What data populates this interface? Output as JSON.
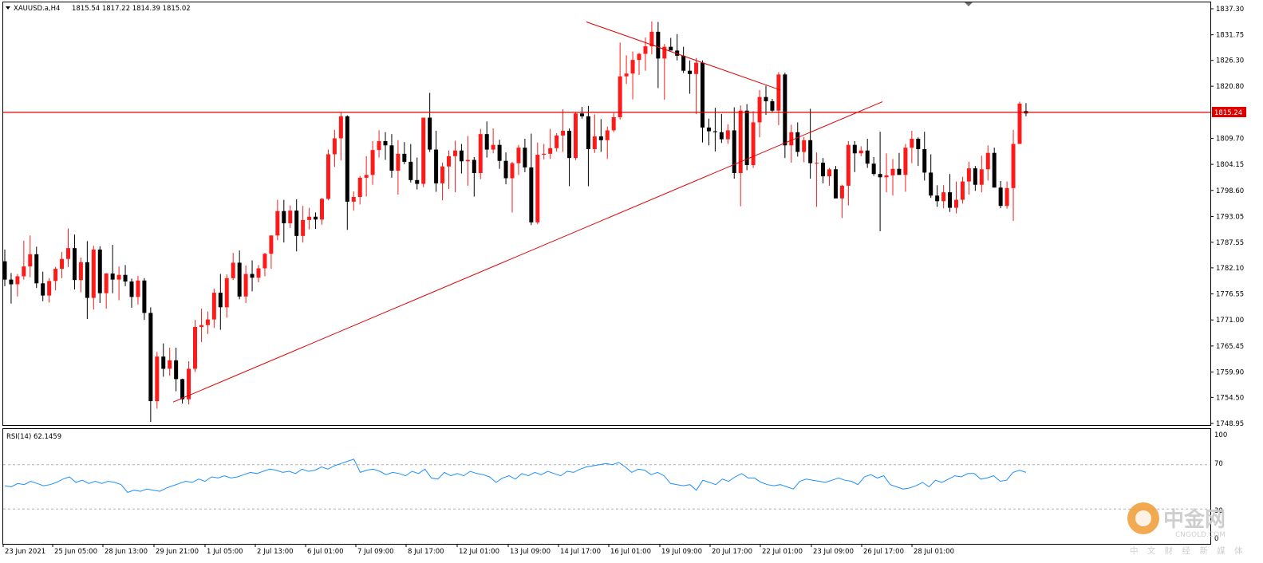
{
  "header": {
    "symbol": "XAUUSD.a,H4",
    "ohlc": "1815.54 1817.22 1814.39 1815.02"
  },
  "rsi": {
    "label": "RSI(14) 62.1459",
    "levels": [
      "100",
      "70",
      "30",
      "0"
    ],
    "values": [
      51,
      50,
      53,
      52,
      55,
      53,
      51,
      52,
      54,
      57,
      59,
      54,
      56,
      53,
      55,
      53,
      55,
      54,
      52,
      45,
      47,
      46,
      48,
      47,
      46,
      49,
      51,
      53,
      55,
      54,
      57,
      55,
      59,
      58,
      60,
      58,
      59,
      61,
      63,
      62,
      64,
      66,
      65,
      63,
      64,
      62,
      66,
      64,
      65,
      68,
      66,
      69,
      71,
      73,
      75,
      63,
      65,
      66,
      64,
      61,
      63,
      62,
      60,
      64,
      62,
      66,
      58,
      57,
      63,
      60,
      62,
      60,
      64,
      62,
      61,
      59,
      54,
      58,
      60,
      57,
      62,
      60,
      63,
      61,
      64,
      62,
      60,
      64,
      63,
      66,
      68,
      69,
      70,
      71,
      70,
      72,
      68,
      63,
      66,
      65,
      61,
      63,
      60,
      53,
      52,
      51,
      52,
      47,
      56,
      54,
      52,
      57,
      55,
      59,
      62,
      58,
      58,
      54,
      52,
      51,
      52,
      50,
      48,
      55,
      57,
      56,
      55,
      54,
      56,
      58,
      56,
      55,
      52,
      59,
      61,
      58,
      60,
      52,
      50,
      48,
      49,
      51,
      54,
      50,
      56,
      54,
      57,
      60,
      59,
      62,
      62,
      57,
      58,
      60,
      55,
      56,
      63,
      65,
      63
    ],
    "color": "#1e90ff"
  },
  "price_axis": {
    "labels": [
      "1837.30",
      "1831.75",
      "1826.30",
      "1820.80",
      "1809.70",
      "1804.15",
      "1798.60",
      "1793.05",
      "1787.55",
      "1782.10",
      "1776.55",
      "1771.00",
      "1765.45",
      "1759.90",
      "1754.50",
      "1748.95"
    ],
    "current_price": "1815.24",
    "current_price_color": "#e00000"
  },
  "time_axis": {
    "labels": [
      "23 Jun 2021",
      "25 Jun 05:00",
      "28 Jun 13:00",
      "29 Jun 21:00",
      "1 Jul 05:00",
      "2 Jul 13:00",
      "6 Jul 01:00",
      "7 Jul 09:00",
      "8 Jul 17:00",
      "12 Jul 01:00",
      "13 Jul 09:00",
      "14 Jul 17:00",
      "16 Jul 01:00",
      "19 Jul 09:00",
      "20 Jul 17:00",
      "22 Jul 01:00",
      "23 Jul 09:00",
      "26 Jul 17:00",
      "28 Jul 01:00"
    ]
  },
  "watermark": {
    "chinese": "中金网",
    "english": "CNGOLD.COM",
    "subtitle": "中 文 财 经 新 媒 体"
  },
  "chart_data": {
    "type": "candlestick",
    "symbol": "XAUUSD.a",
    "timeframe": "H4",
    "y_range": [
      1748.95,
      1837.3
    ],
    "colors": {
      "bull": "#ff1a1a",
      "bear": "#000000",
      "lines": "#e00000"
    },
    "horizontal_line": 1815.24,
    "trendlines": [
      {
        "name": "support",
        "from": [
          "29 Jun 21:00",
          1753.5
        ],
        "to": [
          "23 Jul 09:00",
          1816.5
        ]
      },
      {
        "name": "resistance",
        "from": [
          "14 Jul 17:00",
          1834.5
        ],
        "to": [
          "20 Jul 17:00",
          1822.5
        ]
      }
    ],
    "candles": [
      [
        1783.5,
        1786.0,
        1778.2,
        1779.6
      ],
      [
        1779.6,
        1781.0,
        1774.5,
        1778.6
      ],
      [
        1778.6,
        1780.8,
        1776.0,
        1780.3
      ],
      [
        1780.3,
        1787.9,
        1779.6,
        1782.4
      ],
      [
        1782.4,
        1789.0,
        1780.1,
        1785.0
      ],
      [
        1785.0,
        1786.6,
        1777.8,
        1778.8
      ],
      [
        1778.8,
        1781.3,
        1775.0,
        1776.2
      ],
      [
        1776.2,
        1779.9,
        1774.7,
        1779.3
      ],
      [
        1779.3,
        1782.3,
        1777.3,
        1781.9
      ],
      [
        1781.9,
        1785.5,
        1779.9,
        1784.0
      ],
      [
        1784.0,
        1790.5,
        1782.3,
        1786.3
      ],
      [
        1786.3,
        1789.2,
        1777.5,
        1779.5
      ],
      [
        1779.5,
        1784.3,
        1776.9,
        1783.3
      ],
      [
        1783.3,
        1787.8,
        1771.2,
        1775.7
      ],
      [
        1775.7,
        1786.8,
        1773.2,
        1786.0
      ],
      [
        1786.0,
        1786.7,
        1774.6,
        1776.7
      ],
      [
        1776.7,
        1781.0,
        1773.4,
        1780.9
      ],
      [
        1780.9,
        1787.0,
        1776.7,
        1779.6
      ],
      [
        1779.6,
        1782.4,
        1775.2,
        1780.6
      ],
      [
        1780.6,
        1782.7,
        1778.2,
        1779.2
      ],
      [
        1779.2,
        1779.8,
        1773.6,
        1775.9
      ],
      [
        1775.9,
        1780.4,
        1774.3,
        1779.4
      ],
      [
        1779.4,
        1779.9,
        1771.0,
        1772.5
      ],
      [
        1772.5,
        1773.7,
        1749.3,
        1753.7
      ],
      [
        1753.7,
        1764.2,
        1752.1,
        1763.2
      ],
      [
        1763.2,
        1766.0,
        1758.9,
        1760.6
      ],
      [
        1760.6,
        1765.1,
        1759.1,
        1762.4
      ],
      [
        1762.4,
        1765.1,
        1755.8,
        1758.4
      ],
      [
        1758.4,
        1758.5,
        1753.2,
        1754.1
      ],
      [
        1754.1,
        1762.2,
        1753.0,
        1760.6
      ],
      [
        1760.6,
        1771.0,
        1759.9,
        1769.5
      ],
      [
        1769.5,
        1773.4,
        1766.3,
        1769.9
      ],
      [
        1769.9,
        1772.8,
        1768.0,
        1771.1
      ],
      [
        1771.1,
        1777.7,
        1769.3,
        1776.8
      ],
      [
        1776.8,
        1780.8,
        1768.9,
        1773.7
      ],
      [
        1773.7,
        1780.7,
        1771.5,
        1779.9
      ],
      [
        1779.9,
        1785.3,
        1779.5,
        1783.2
      ],
      [
        1783.2,
        1785.8,
        1775.4,
        1776.0
      ],
      [
        1776.0,
        1782.6,
        1774.6,
        1780.8
      ],
      [
        1780.8,
        1783.7,
        1777.1,
        1780.0
      ],
      [
        1780.0,
        1782.7,
        1779.0,
        1782.0
      ],
      [
        1782.0,
        1785.3,
        1780.3,
        1785.1
      ],
      [
        1785.1,
        1789.0,
        1781.9,
        1789.0
      ],
      [
        1789.0,
        1796.6,
        1788.0,
        1794.2
      ],
      [
        1794.2,
        1796.6,
        1787.5,
        1791.6
      ],
      [
        1791.6,
        1795.4,
        1790.6,
        1794.3
      ],
      [
        1794.3,
        1796.7,
        1785.6,
        1788.9
      ],
      [
        1788.9,
        1795.3,
        1787.5,
        1792.3
      ],
      [
        1792.3,
        1794.9,
        1790.3,
        1793.0
      ],
      [
        1793.0,
        1793.9,
        1790.4,
        1792.4
      ],
      [
        1792.4,
        1797.0,
        1791.3,
        1796.8
      ],
      [
        1796.8,
        1807.3,
        1796.5,
        1806.3
      ],
      [
        1806.3,
        1811.5,
        1803.6,
        1809.7
      ],
      [
        1809.7,
        1815.3,
        1805.0,
        1814.4
      ],
      [
        1814.4,
        1814.6,
        1790.2,
        1796.2
      ],
      [
        1796.2,
        1798.4,
        1794.3,
        1797.2
      ],
      [
        1797.2,
        1801.7,
        1795.6,
        1801.3
      ],
      [
        1801.3,
        1805.9,
        1797.3,
        1801.9
      ],
      [
        1801.9,
        1809.1,
        1799.8,
        1807.2
      ],
      [
        1807.2,
        1811.4,
        1805.6,
        1809.1
      ],
      [
        1809.1,
        1811.0,
        1805.1,
        1808.2
      ],
      [
        1808.2,
        1810.6,
        1801.3,
        1802.8
      ],
      [
        1802.8,
        1809.3,
        1797.7,
        1806.4
      ],
      [
        1806.4,
        1808.9,
        1804.2,
        1804.7
      ],
      [
        1804.7,
        1808.5,
        1800.3,
        1800.8
      ],
      [
        1800.8,
        1805.6,
        1798.8,
        1800.0
      ],
      [
        1800.0,
        1813.9,
        1799.3,
        1814.1
      ],
      [
        1814.1,
        1819.4,
        1806.8,
        1807.3
      ],
      [
        1807.3,
        1811.3,
        1798.3,
        1800.1
      ],
      [
        1800.1,
        1804.5,
        1796.5,
        1803.7
      ],
      [
        1803.7,
        1807.1,
        1798.9,
        1805.9
      ],
      [
        1805.9,
        1809.2,
        1798.2,
        1807.1
      ],
      [
        1807.1,
        1808.5,
        1802.2,
        1804.8
      ],
      [
        1804.8,
        1810.2,
        1799.6,
        1805.1
      ],
      [
        1805.1,
        1805.7,
        1797.3,
        1802.3
      ],
      [
        1802.3,
        1811.7,
        1801.0,
        1810.6
      ],
      [
        1810.6,
        1813.3,
        1805.6,
        1807.3
      ],
      [
        1807.3,
        1811.8,
        1806.5,
        1808.3
      ],
      [
        1808.3,
        1809.4,
        1803.2,
        1804.9
      ],
      [
        1804.9,
        1806.7,
        1799.9,
        1801.2
      ],
      [
        1801.2,
        1804.7,
        1793.9,
        1804.4
      ],
      [
        1804.4,
        1808.3,
        1801.9,
        1807.7
      ],
      [
        1807.7,
        1809.6,
        1802.5,
        1803.5
      ],
      [
        1803.5,
        1810.7,
        1791.2,
        1791.8
      ],
      [
        1791.8,
        1808.8,
        1791.4,
        1806.2
      ],
      [
        1806.2,
        1808.5,
        1805.2,
        1806.4
      ],
      [
        1806.4,
        1811.7,
        1805.3,
        1807.6
      ],
      [
        1807.6,
        1810.8,
        1806.9,
        1810.3
      ],
      [
        1810.3,
        1815.9,
        1806.8,
        1811.3
      ],
      [
        1811.3,
        1811.8,
        1799.5,
        1805.5
      ],
      [
        1805.5,
        1815.3,
        1805.1,
        1815.0
      ],
      [
        1815.0,
        1816.4,
        1813.9,
        1814.4
      ],
      [
        1814.4,
        1816.6,
        1799.5,
        1807.4
      ],
      [
        1807.4,
        1814.8,
        1806.6,
        1810.1
      ],
      [
        1810.1,
        1813.8,
        1806.8,
        1809.3
      ],
      [
        1809.3,
        1812.2,
        1805.3,
        1811.4
      ],
      [
        1811.4,
        1815.1,
        1811.0,
        1814.2
      ],
      [
        1814.2,
        1830.1,
        1813.7,
        1822.9
      ],
      [
        1822.9,
        1827.4,
        1821.3,
        1823.5
      ],
      [
        1823.5,
        1828.2,
        1818.0,
        1826.4
      ],
      [
        1826.4,
        1827.9,
        1823.2,
        1827.7
      ],
      [
        1827.7,
        1831.2,
        1824.1,
        1829.3
      ],
      [
        1829.3,
        1834.6,
        1827.6,
        1832.4
      ],
      [
        1832.4,
        1834.5,
        1820.4,
        1826.7
      ],
      [
        1826.7,
        1829.8,
        1817.9,
        1829.2
      ],
      [
        1829.2,
        1831.1,
        1828.5,
        1828.4
      ],
      [
        1828.4,
        1831.9,
        1826.3,
        1827.3
      ],
      [
        1827.3,
        1829.2,
        1823.6,
        1824.1
      ],
      [
        1824.1,
        1826.3,
        1819.2,
        1823.4
      ],
      [
        1823.4,
        1826.8,
        1814.9,
        1825.8
      ],
      [
        1825.8,
        1826.3,
        1808.8,
        1812.0
      ],
      [
        1812.0,
        1813.9,
        1808.2,
        1811.2
      ],
      [
        1811.2,
        1816.2,
        1806.9,
        1811.0
      ],
      [
        1811.0,
        1814.9,
        1808.7,
        1809.5
      ],
      [
        1809.5,
        1812.7,
        1808.5,
        1811.4
      ],
      [
        1811.4,
        1816.3,
        1801.1,
        1802.3
      ],
      [
        1802.3,
        1816.7,
        1795.2,
        1815.6
      ],
      [
        1815.6,
        1817.0,
        1802.9,
        1804.0
      ],
      [
        1804.0,
        1815.5,
        1803.4,
        1813.1
      ],
      [
        1813.1,
        1820.0,
        1809.9,
        1818.5
      ],
      [
        1818.5,
        1820.9,
        1814.7,
        1817.6
      ],
      [
        1817.6,
        1818.1,
        1815.3,
        1815.6
      ],
      [
        1815.6,
        1823.8,
        1812.5,
        1823.3
      ],
      [
        1823.3,
        1823.7,
        1805.5,
        1808.2
      ],
      [
        1808.2,
        1812.6,
        1804.5,
        1811.0
      ],
      [
        1811.0,
        1813.1,
        1805.8,
        1806.8
      ],
      [
        1806.8,
        1810.0,
        1804.6,
        1809.3
      ],
      [
        1809.3,
        1816.0,
        1801.1,
        1804.4
      ],
      [
        1804.4,
        1806.7,
        1795.1,
        1804.5
      ],
      [
        1804.5,
        1805.5,
        1800.1,
        1801.6
      ],
      [
        1801.6,
        1803.4,
        1799.6,
        1803.1
      ],
      [
        1803.1,
        1803.8,
        1800.1,
        1796.9
      ],
      [
        1796.9,
        1799.8,
        1792.7,
        1799.6
      ],
      [
        1799.6,
        1809.1,
        1795.4,
        1808.3
      ],
      [
        1808.3,
        1809.1,
        1802.5,
        1806.5
      ],
      [
        1806.5,
        1808.0,
        1805.9,
        1807.1
      ],
      [
        1807.1,
        1809.6,
        1803.4,
        1804.3
      ],
      [
        1804.3,
        1805.7,
        1801.7,
        1802.1
      ],
      [
        1802.1,
        1811.1,
        1789.9,
        1801.4
      ],
      [
        1801.4,
        1806.5,
        1798.2,
        1801.8
      ],
      [
        1801.8,
        1805.3,
        1797.5,
        1803.2
      ],
      [
        1803.2,
        1806.6,
        1802.0,
        1801.9
      ],
      [
        1801.9,
        1808.5,
        1798.3,
        1807.7
      ],
      [
        1807.7,
        1811.3,
        1804.4,
        1809.6
      ],
      [
        1809.6,
        1809.9,
        1803.8,
        1807.4
      ],
      [
        1807.4,
        1811.1,
        1800.7,
        1802.4
      ],
      [
        1802.4,
        1806.3,
        1797.0,
        1797.5
      ],
      [
        1797.5,
        1799.7,
        1795.1,
        1796.3
      ],
      [
        1796.3,
        1799.7,
        1794.8,
        1798.2
      ],
      [
        1798.2,
        1802.1,
        1794.0,
        1794.9
      ],
      [
        1794.9,
        1800.5,
        1793.7,
        1796.6
      ],
      [
        1796.6,
        1801.5,
        1795.8,
        1800.5
      ],
      [
        1800.5,
        1804.7,
        1797.7,
        1803.3
      ],
      [
        1803.3,
        1803.8,
        1798.5,
        1799.8
      ],
      [
        1799.8,
        1806.0,
        1798.2,
        1803.1
      ],
      [
        1803.1,
        1808.2,
        1800.7,
        1806.6
      ],
      [
        1806.6,
        1807.7,
        1799.7,
        1799.2
      ],
      [
        1799.2,
        1800.6,
        1794.8,
        1795.3
      ],
      [
        1795.3,
        1800.5,
        1794.7,
        1799.1
      ],
      [
        1799.1,
        1811.5,
        1792.1,
        1808.5
      ],
      [
        1808.5,
        1817.5,
        1809.9,
        1817.1
      ],
      [
        1815.5,
        1817.2,
        1814.4,
        1815.0
      ]
    ]
  }
}
